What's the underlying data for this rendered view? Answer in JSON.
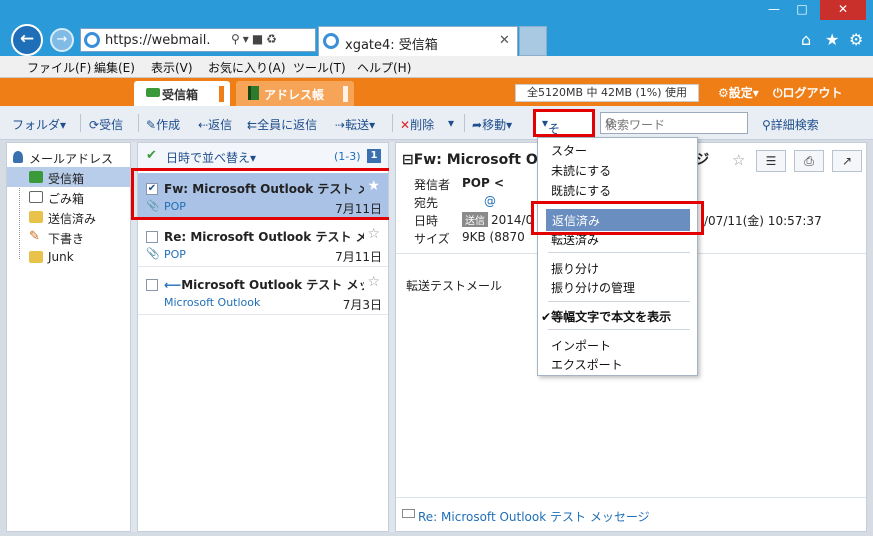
{
  "browser": {
    "address": "https://webmail.",
    "tab_title": "xgate4: 受信箱",
    "menu": [
      "ファイル(F)",
      "編集(E)",
      "表示(V)",
      "お気に入り(A)",
      "ツール(T)",
      "ヘルプ(H)"
    ]
  },
  "app": {
    "tabs": [
      "受信箱",
      "アドレス帳"
    ],
    "usage": "全5120MB 中 42MB (1%) 使用",
    "settings": "設定",
    "logout": "ログアウト"
  },
  "toolbar": {
    "folder": "フォルダ",
    "receive": "受信",
    "compose": "作成",
    "reply": "返信",
    "reply_all": "全員に返信",
    "forward": "転送",
    "delete": "削除",
    "move": "移動",
    "other": "その他",
    "search_placeholder": "検索ワード",
    "advanced_search": "詳細検索"
  },
  "folders": {
    "root": "メールアドレス",
    "items": [
      "受信箱",
      "ごみ箱",
      "送信済み",
      "下書き",
      "Junk"
    ]
  },
  "message_list": {
    "sort_label": "日時で並べ替え",
    "count": "(1-3)",
    "page": "1",
    "messages": [
      {
        "subject": "Fw: Microsoft Outlook テスト メッセージ",
        "from": "POP",
        "date": "7月11日"
      },
      {
        "subject": "Re: Microsoft Outlook テスト メッセージ",
        "from": "POP",
        "date": "7月11日"
      },
      {
        "subject": "Microsoft Outlook テスト メッセージ",
        "from": "Microsoft Outlook",
        "date": "7月3日"
      }
    ]
  },
  "preview": {
    "title": "Fw: Microsoft Outlook テスト メッセージ",
    "labels": [
      "発信者",
      "宛先",
      "日時",
      "サイズ"
    ],
    "from": "POP <",
    "to": "@",
    "sent_badge": "送信",
    "date_prefix": "2014/0",
    "date_suffix": "/07/11(金) 10:57:37",
    "size": "9KB (8870",
    "body": "転送テストメール",
    "footer_link": "Re: Microsoft Outlook テスト メッセージ"
  },
  "dropdown": {
    "items": [
      "スター",
      "未読にする",
      "既読にする",
      "返信済み",
      "転送済み",
      "振り分け",
      "振り分けの管理",
      "等幅文字で本文を表示",
      "インポート",
      "エクスポート"
    ]
  },
  "colors": {
    "accent_orange": "#f07e17",
    "browser_blue": "#2a9bd8",
    "highlight": "#6a8ec0",
    "annotation_red": "#e30000"
  }
}
